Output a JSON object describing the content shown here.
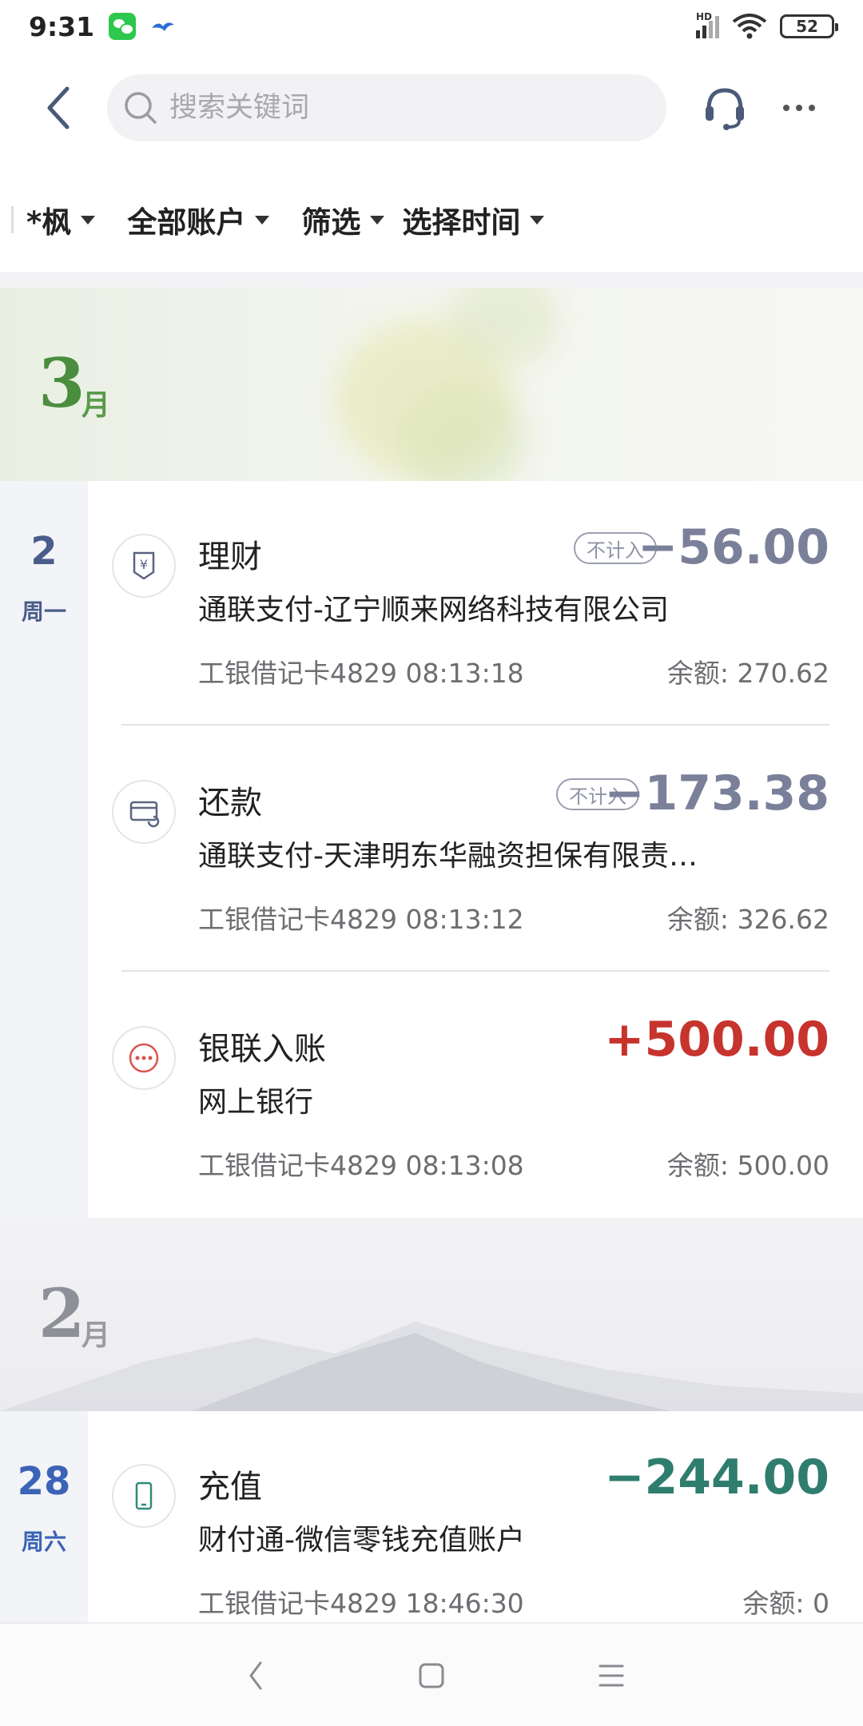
{
  "status": {
    "time": "9:31",
    "network": "HD",
    "battery": "52"
  },
  "header": {
    "search_placeholder": "搜索关键词"
  },
  "filters": [
    {
      "label": "*枫"
    },
    {
      "label": "全部账户"
    },
    {
      "label": "筛选"
    },
    {
      "label": "选择时间"
    }
  ],
  "months": [
    {
      "num": "3",
      "suffix": "月"
    },
    {
      "num": "2",
      "suffix": "月"
    }
  ],
  "days": [
    {
      "day": "2",
      "weekday": "周一"
    },
    {
      "day": "28",
      "weekday": "周六"
    }
  ],
  "transactions": [
    {
      "icon": "wealth-icon",
      "category": "理财",
      "badge": "不计入",
      "amount": "−56.00",
      "merchant": "通联支付-辽宁顺来网络科技有限公司",
      "meta": "工银借记卡4829  08:13:18",
      "balance": "余额: 270.62"
    },
    {
      "icon": "repayment-icon",
      "category": "还款",
      "badge": "不计入",
      "amount": "−173.38",
      "merchant": "通联支付-天津明东华融资担保有限责…",
      "meta": "工银借记卡4829  08:13:12",
      "balance": "余额: 326.62"
    },
    {
      "icon": "more-circle-icon",
      "category": "银联入账",
      "amount": "+500.00",
      "merchant": "网上银行",
      "meta": "工银借记卡4829  08:13:08",
      "balance": "余额: 500.00"
    },
    {
      "icon": "phone-icon",
      "category": "充值",
      "amount": "−244.00",
      "merchant": "财付通-微信零钱充值账户",
      "meta": "工银借记卡4829  18:46:30",
      "balance": "余额: 0"
    }
  ],
  "colors": {
    "expense_excluded": "#7b809a",
    "income": "#c7332d",
    "expense": "#2f7d6e"
  }
}
